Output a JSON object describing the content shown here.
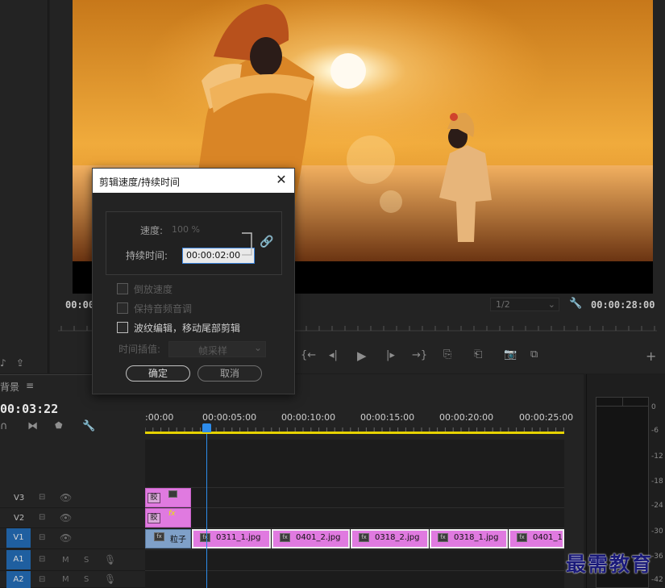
{
  "monitor": {
    "timecode_left": "00:00",
    "timecode_right": "00:00:28:00",
    "resolution": "1/2"
  },
  "timeline": {
    "sequence_label": "背景",
    "menu_glyph": "≡",
    "playhead_timecode": "00:03:22",
    "ruler_labels": [
      ":00:00",
      "00:00:05:00",
      "00:00:10:00",
      "00:00:15:00",
      "00:00:20:00",
      "00:00:25:00"
    ],
    "tracks": [
      {
        "name": "V3",
        "kind": "video"
      },
      {
        "name": "V2",
        "kind": "video"
      },
      {
        "name": "V1",
        "kind": "video"
      },
      {
        "name": "A1",
        "kind": "audio",
        "m": "M",
        "s": "S"
      },
      {
        "name": "A2",
        "kind": "audio",
        "m": "M",
        "s": "S"
      }
    ],
    "v3_clip_label": "胶",
    "v2_clip_label": "胶",
    "v2_fx_label": "fx",
    "v1_clips": [
      {
        "label": "粒子",
        "fx": "fx"
      },
      {
        "label": "0311_1.jpg",
        "fx": "fx"
      },
      {
        "label": "0401_2.jpg",
        "fx": "fx"
      },
      {
        "label": "0318_2.jpg",
        "fx": "fx"
      },
      {
        "label": "0318_1.jpg",
        "fx": "fx"
      },
      {
        "label": "0401_1.j",
        "fx": "fx"
      }
    ]
  },
  "meters": {
    "db_labels": [
      "0",
      "-6",
      "-12",
      "-18",
      "-24",
      "-30",
      "-36",
      "-42"
    ]
  },
  "dialog": {
    "title": "剪辑速度/持续时间",
    "speed_label": "速度:",
    "speed_value": "100 %",
    "duration_label": "持续时间:",
    "duration_value": "00:00:02:00",
    "reverse_label": "倒放速度",
    "reverse_checked": false,
    "maintain_pitch_label": "保持音频音调",
    "maintain_pitch_checked": false,
    "ripple_label": "波纹编辑，移动尾部剪辑",
    "ripple_checked": false,
    "interp_label": "时间插值:",
    "interp_value": "帧采样",
    "ok_label": "确定",
    "cancel_label": "取消"
  },
  "watermark": "最需教育",
  "colors": {
    "clip_pink": "#e07ae0",
    "v1_track_active": "#1f5fa0",
    "playhead_blue": "#2d8ceb",
    "work_area_yellow": "#e6d200",
    "dialog_accent": "#3c84dc"
  }
}
